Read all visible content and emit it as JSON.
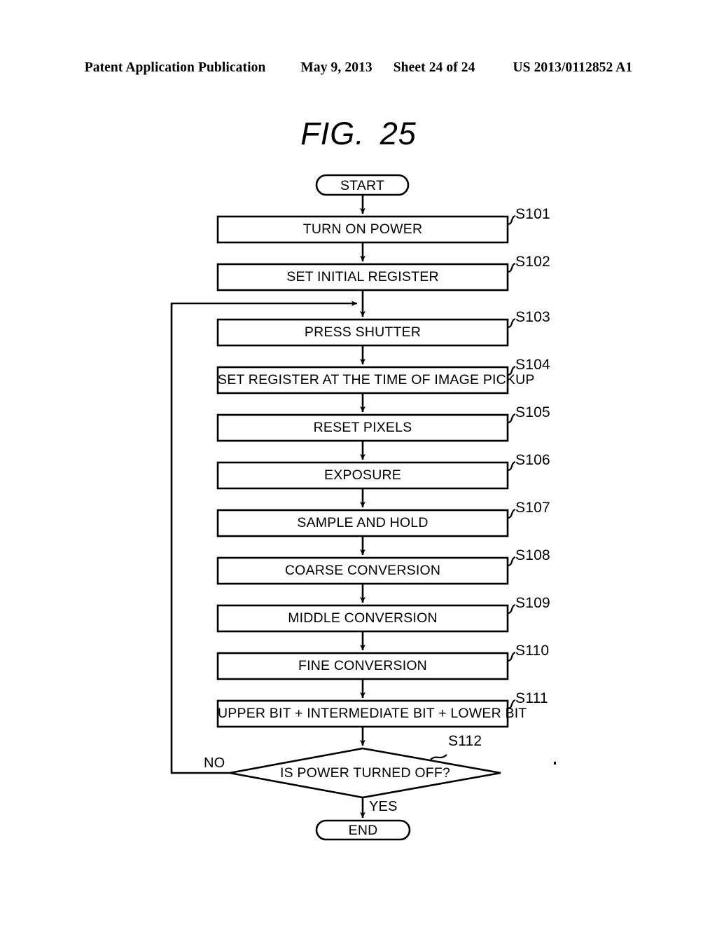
{
  "header": {
    "publication": "Patent Application Publication",
    "date": "May 9, 2013",
    "sheet": "Sheet 24 of 24",
    "patent_number": "US 2013/0112852 A1"
  },
  "figure": {
    "label": "FIG.",
    "number": "25"
  },
  "flowchart": {
    "start": "START",
    "end": "END",
    "decision": "IS POWER TURNED OFF?",
    "decision_step": "S112",
    "branch_no": "NO",
    "branch_yes": "YES",
    "steps": [
      {
        "text": "TURN ON POWER",
        "step": "S101"
      },
      {
        "text": "SET INITIAL REGISTER",
        "step": "S102"
      },
      {
        "text": "PRESS SHUTTER",
        "step": "S103"
      },
      {
        "text": "SET REGISTER AT THE TIME OF IMAGE PICKUP",
        "step": "S104"
      },
      {
        "text": "RESET PIXELS",
        "step": "S105"
      },
      {
        "text": "EXPOSURE",
        "step": "S106"
      },
      {
        "text": "SAMPLE AND HOLD",
        "step": "S107"
      },
      {
        "text": "COARSE CONVERSION",
        "step": "S108"
      },
      {
        "text": "MIDDLE CONVERSION",
        "step": "S109"
      },
      {
        "text": "FINE CONVERSION",
        "step": "S110"
      },
      {
        "text": "UPPER BIT + INTERMEDIATE BIT + LOWER BIT",
        "step": "S111"
      }
    ]
  },
  "colors": {
    "ink": "#000000",
    "paper": "#ffffff"
  }
}
